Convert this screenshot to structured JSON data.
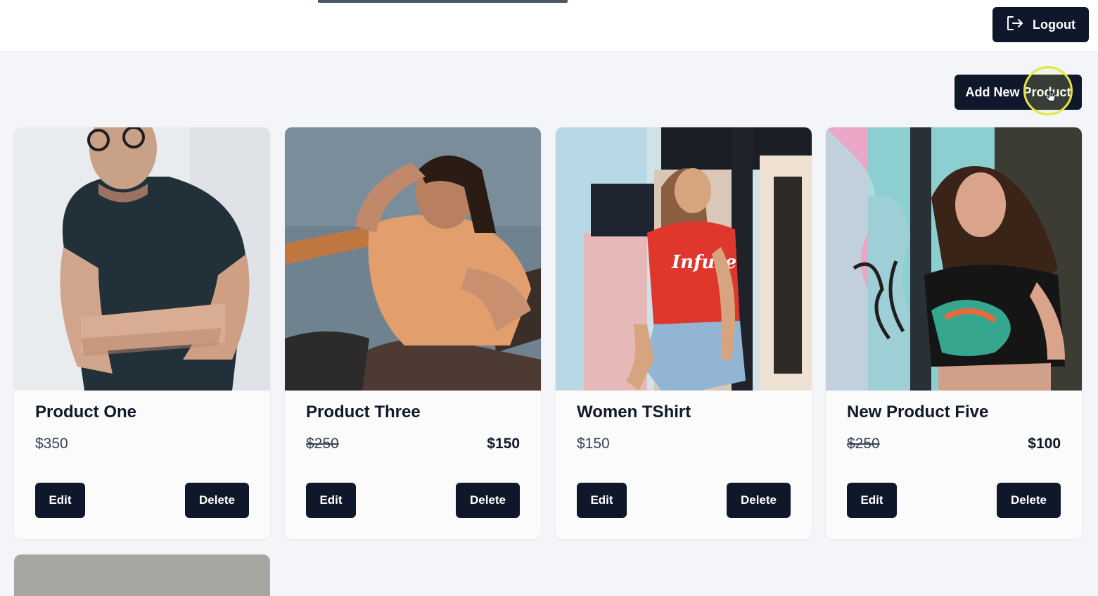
{
  "header": {
    "logout_label": "Logout",
    "logout_icon": "logout-icon"
  },
  "toolbar": {
    "add_product_label": "Add New Product"
  },
  "products": [
    {
      "name": "Product One",
      "price": "$350",
      "old_price": "",
      "sale_price": "",
      "edit_label": "Edit",
      "delete_label": "Delete",
      "image": "man-dark-tank-top-photo"
    },
    {
      "name": "Product Three",
      "price": "",
      "old_price": "$250",
      "sale_price": "$150",
      "edit_label": "Edit",
      "delete_label": "Delete",
      "image": "man-orange-tshirt-photo"
    },
    {
      "name": "Women TShirt",
      "price": "$150",
      "old_price": "",
      "sale_price": "",
      "edit_label": "Edit",
      "delete_label": "Delete",
      "image": "woman-red-tshirt-photo"
    },
    {
      "name": "New Product Five",
      "price": "",
      "old_price": "$250",
      "sale_price": "$100",
      "edit_label": "Edit",
      "delete_label": "Delete",
      "image": "woman-black-graphic-tee-photo"
    }
  ],
  "colors": {
    "button_bg": "#0f172a",
    "button_text": "#ffffff",
    "page_bg": "#f4f5f8",
    "card_bg": "#fbfbfc"
  }
}
